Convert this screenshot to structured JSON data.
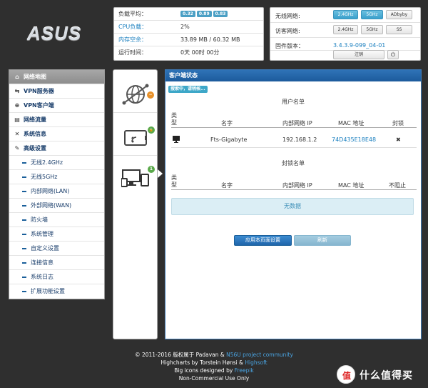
{
  "logo": {
    "text": "ASUS"
  },
  "stats": {
    "load_label": "负载平均：",
    "load_values": [
      "0.32",
      "0.89",
      "0.83"
    ],
    "cpu_label": "CPU负载：",
    "cpu_value": "2%",
    "mem_label": "内存空余：",
    "mem_value": "33.89 MB / 60.32 MB",
    "uptime_label": "运行时间：",
    "uptime_value": "0天 00时 00分"
  },
  "network": {
    "wireless_label": "无线网络:",
    "wireless_buttons": [
      "2.4GHz",
      "5GHz",
      "ADbyby"
    ],
    "guest_label": "访客网络:",
    "guest_buttons": [
      "2.4GHz",
      "5GHz",
      "SS"
    ],
    "firmware_label": "固件版本：",
    "firmware_value": "3.4.3.9-099_04-01",
    "logout_label": "注销",
    "power_icon": "⏻"
  },
  "menu": {
    "items": [
      {
        "label": "网络地图",
        "icon": "⌂"
      },
      {
        "label": "VPN服务器",
        "icon": "⇆"
      },
      {
        "label": "VPN客户端",
        "icon": "⊕"
      },
      {
        "label": "网络流量",
        "icon": "▤"
      },
      {
        "label": "系统信息",
        "icon": "✕"
      },
      {
        "label": "高级设置",
        "icon": "✎"
      }
    ],
    "subitems": [
      "无线2.4GHz",
      "无线5GHz",
      "内部网络(LAN)",
      "外部网络(WAN)",
      "防火墙",
      "系统管理",
      "自定义设置",
      "连接信息",
      "系统日志",
      "扩展功能设置"
    ]
  },
  "devices": {
    "internet_badge": "−",
    "wireless_badge": "🔒",
    "clients_badge": "1"
  },
  "client": {
    "header": "客户端状态",
    "scan_tag": "搜索中，请稍候...",
    "user_list_title": "用户名单",
    "blocked_list_title": "封锁名单",
    "columns": {
      "type": "类型",
      "hostname": "名字",
      "ip": "内部网络 IP",
      "mac": "MAC 地址",
      "block": "封锁",
      "unblock": "不阻止"
    },
    "rows": [
      {
        "name": "Fts-Gigabyte",
        "ip": "192.168.1.2",
        "mac": "74D435E18E48",
        "block": "✖"
      }
    ],
    "no_data": "无数据",
    "apply_label": "应用本页面设置",
    "refresh_label": "刷新"
  },
  "footer": {
    "line1_a": "© 2011-2016 版权属于 Padavan & ",
    "line1_link": "N56U project community",
    "line2_a": "Highcharts by Torstein Hønsi & ",
    "line2_link": "Highsoft",
    "line3_a": "Big icons designed by ",
    "line3_link": "Freepik",
    "line4": "Non-Commercial Use Only"
  },
  "watermark": {
    "glyph": "值",
    "text": "什么值得买"
  },
  "colors": {
    "accent": "#1c5b9c",
    "active_pill": "#3aa0cc",
    "badge_orange": "#e8912a",
    "badge_green": "#5aa94a"
  }
}
